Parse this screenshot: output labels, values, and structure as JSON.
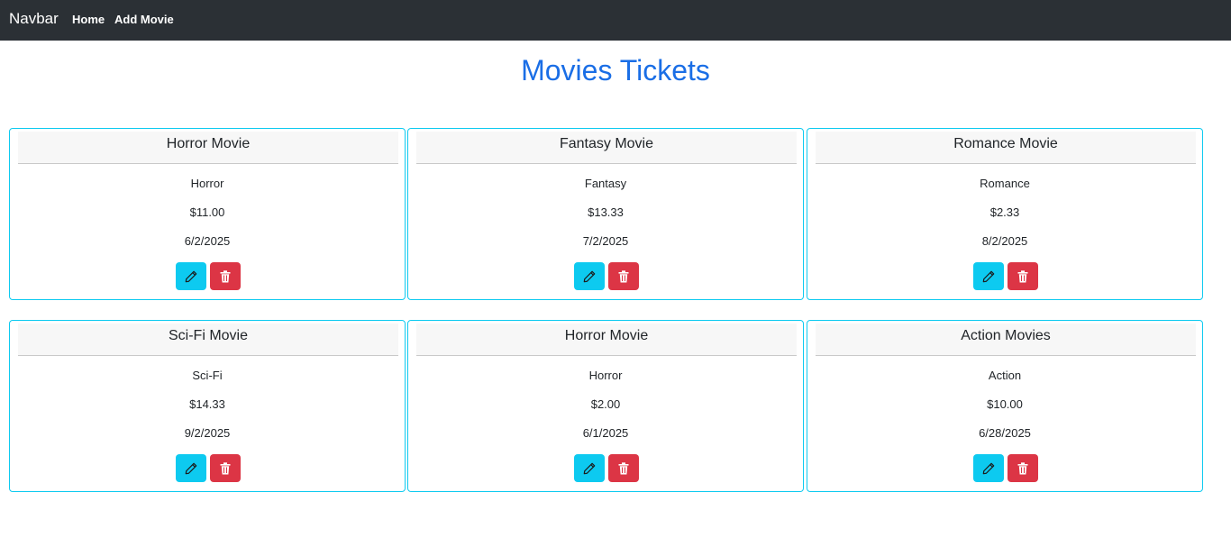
{
  "navbar": {
    "brand": "Navbar",
    "links": [
      {
        "label": "Home"
      },
      {
        "label": "Add Movie"
      }
    ]
  },
  "page": {
    "title": "Movies Tickets"
  },
  "colors": {
    "navbar_bg": "#2b3035",
    "title": "#1a6ee6",
    "card_border": "#0dcaf0",
    "edit_button": "#0dcaf0",
    "delete_button": "#dc3545"
  },
  "icons": {
    "edit": "pencil-icon",
    "delete": "trash-icon"
  },
  "movies": [
    {
      "title": "Horror Movie",
      "genre": "Horror",
      "price": "$11.00",
      "date": "6/2/2025"
    },
    {
      "title": "Fantasy Movie",
      "genre": "Fantasy",
      "price": "$13.33",
      "date": "7/2/2025"
    },
    {
      "title": "Romance Movie",
      "genre": "Romance",
      "price": "$2.33",
      "date": "8/2/2025"
    },
    {
      "title": "Sci-Fi Movie",
      "genre": "Sci-Fi",
      "price": "$14.33",
      "date": "9/2/2025"
    },
    {
      "title": "Horror Movie",
      "genre": "Horror",
      "price": "$2.00",
      "date": "6/1/2025"
    },
    {
      "title": "Action Movies",
      "genre": "Action",
      "price": "$10.00",
      "date": "6/28/2025"
    }
  ]
}
